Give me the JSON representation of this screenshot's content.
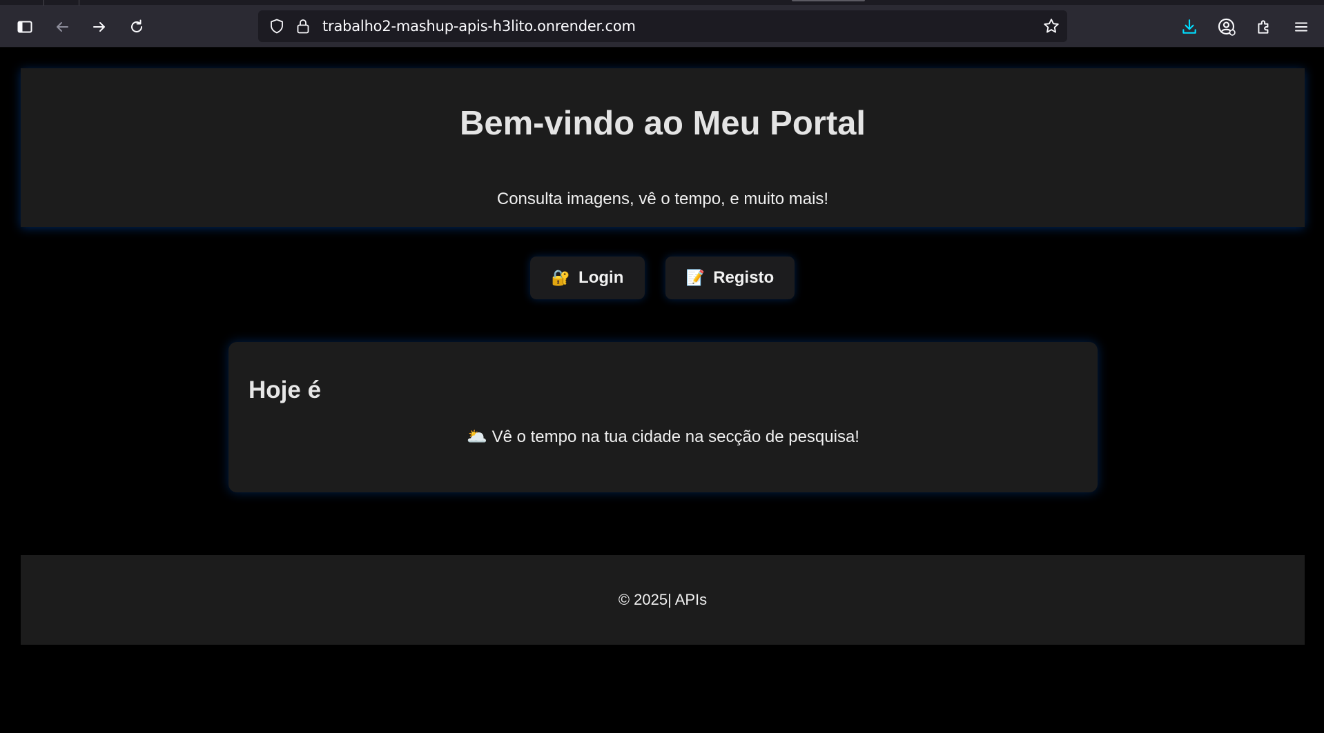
{
  "browser": {
    "url": "trabalho2-mashup-apis-h3lito.onrender.com",
    "icons": {
      "sidebar": "sidebar-icon",
      "back": "back-arrow-icon",
      "forward": "forward-arrow-icon",
      "reload": "reload-icon",
      "tracking": "shield-icon",
      "security": "lock-icon",
      "bookmark": "star-icon",
      "downloads": "download-icon",
      "account": "account-icon",
      "extensions": "puzzle-icon",
      "menu": "hamburger-menu-icon"
    },
    "colors": {
      "toolbar": "#2b2a33",
      "urlbar": "#1c1b22",
      "download_accent": "#00ddff"
    }
  },
  "header": {
    "title": "Bem-vindo ao Meu Portal",
    "subtitle": "Consulta imagens, vê o tempo, e muito mais!"
  },
  "auth": {
    "login": {
      "emoji": "🔐",
      "label": "Login"
    },
    "register": {
      "emoji": "📝",
      "label": "Registo"
    }
  },
  "today_card": {
    "heading": "Hoje é",
    "weather_emoji": "🌥️",
    "weather_text": "Vê o tempo na tua cidade na secção de pesquisa!"
  },
  "footer": {
    "copyright": "© 2025| APIs"
  },
  "colors": {
    "page_bg": "#000000",
    "panel_bg": "#1c1c1c",
    "glow": "#006eff"
  }
}
